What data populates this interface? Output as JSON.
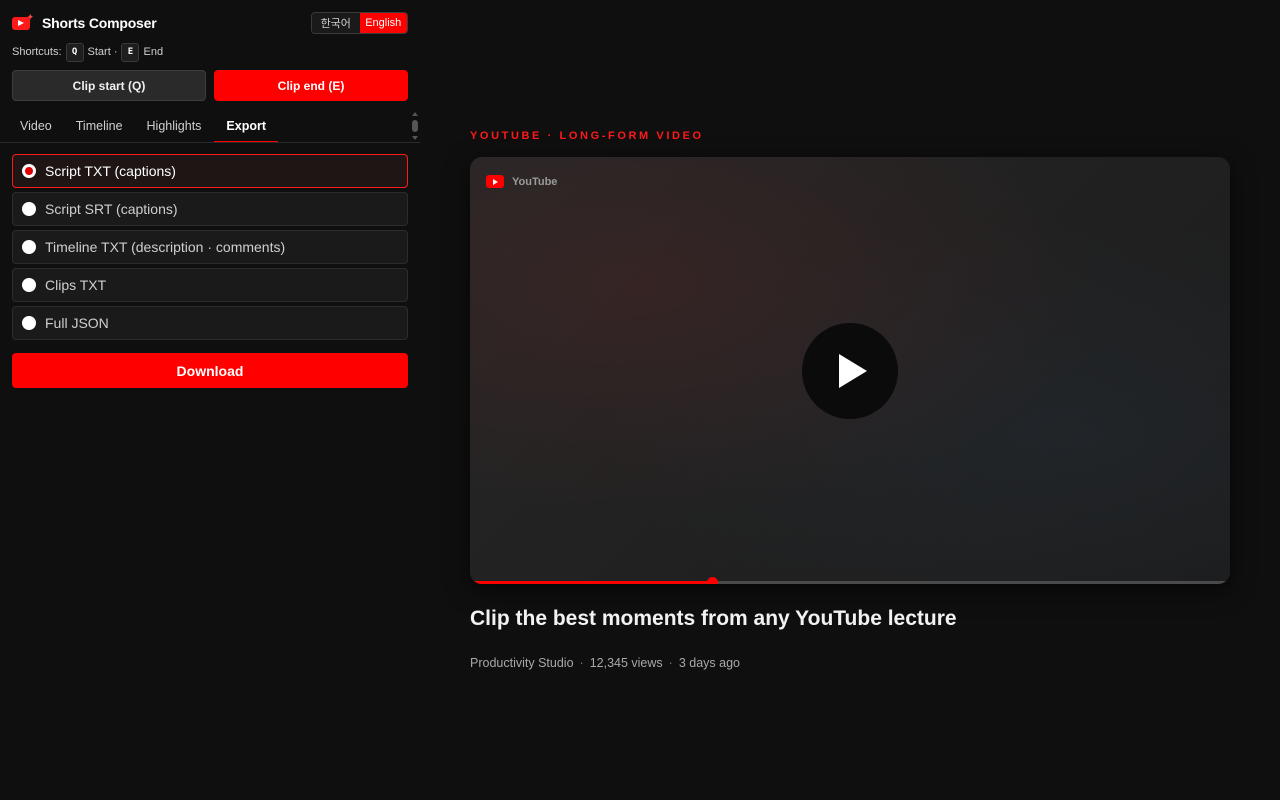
{
  "app": {
    "title": "Shorts Composer",
    "accent_color": "#ff0000"
  },
  "language": {
    "options": [
      "한국어",
      "English"
    ],
    "selected": "English"
  },
  "shortcuts": {
    "label": "Shortcuts:",
    "start_key": "Q",
    "start_label": "Start ·",
    "end_key": "E",
    "end_label": "End"
  },
  "clip_buttons": {
    "start_label": "Clip start (Q)",
    "end_label": "Clip end (E)"
  },
  "tabs": [
    {
      "label": "Video",
      "active": false
    },
    {
      "label": "Timeline",
      "active": false
    },
    {
      "label": "Highlights",
      "active": false
    },
    {
      "label": "Export",
      "active": true
    }
  ],
  "export_options": [
    {
      "label": "Script TXT (captions)",
      "selected": true
    },
    {
      "label": "Script SRT (captions)",
      "selected": false
    },
    {
      "label": "Timeline TXT (description · comments)",
      "selected": false
    },
    {
      "label": "Clips TXT",
      "selected": false
    },
    {
      "label": "Full JSON",
      "selected": false
    }
  ],
  "download_label": "Download",
  "main": {
    "kicker": "YOUTUBE · LONG-FORM VIDEO",
    "player": {
      "badge": "YouTube",
      "progress_fraction": 0.318
    },
    "video_title": "Clip the best moments from any YouTube lecture",
    "channel": "Productivity Studio",
    "views": "12,345 views",
    "age": "3 days ago",
    "separator": "·"
  }
}
